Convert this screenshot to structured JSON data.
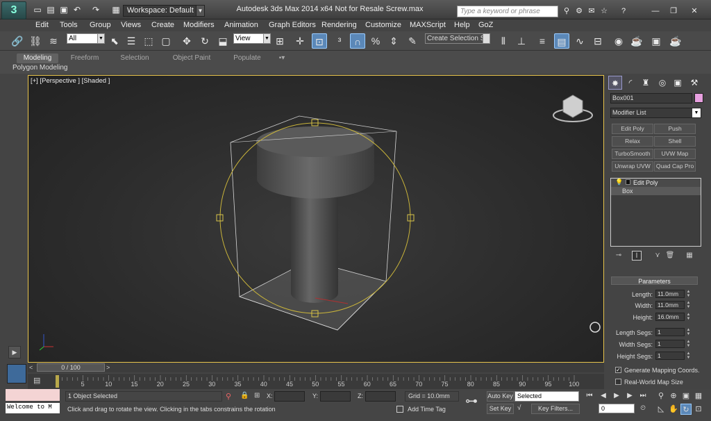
{
  "title_bar": {
    "workspace": "Workspace: Default",
    "window_title": "Autodesk 3ds Max  2014 x64     Not for Resale     Screw.max",
    "search_placeholder": "Type a keyword or phrase"
  },
  "menu": [
    "Edit",
    "Tools",
    "Group",
    "Views",
    "Create",
    "Modifiers",
    "Animation",
    "Graph Editors",
    "Rendering",
    "Customize",
    "MAXScript",
    "Help",
    "GoZ"
  ],
  "toolbar": {
    "selection_filter": "All",
    "reference_coord": "View",
    "selection_set": "Create Selection Se"
  },
  "ribbon": {
    "tabs": [
      "Modeling",
      "Freeform",
      "Selection",
      "Object Paint",
      "Populate"
    ],
    "active_tab": "Modeling",
    "panel_label": "Polygon Modeling"
  },
  "viewport": {
    "label": "[+] [Perspective ] [Shaded ]"
  },
  "command_panel": {
    "object_name": "Box001",
    "object_color": "#e8a0e0",
    "modifier_list": "Modifier List",
    "modifier_buttons": [
      "Edit Poly",
      "Push",
      "Relax",
      "Shell",
      "TurboSmooth",
      "UVW Map",
      "Unwrap UVW",
      "Quad Cap Pro"
    ],
    "stack": [
      "Edit Poly",
      "Box"
    ],
    "rollout_title": "Parameters",
    "params": [
      {
        "label": "Length:",
        "value": "11.0mm"
      },
      {
        "label": "Width:",
        "value": "11.0mm"
      },
      {
        "label": "Height:",
        "value": "16.0mm"
      },
      {
        "label": "Length Segs:",
        "value": "1"
      },
      {
        "label": "Width Segs:",
        "value": "1"
      },
      {
        "label": "Height Segs:",
        "value": "1"
      }
    ],
    "checkboxes": [
      {
        "label": "Generate Mapping Coords.",
        "checked": true
      },
      {
        "label": "Real-World Map Size",
        "checked": false
      }
    ]
  },
  "timeline": {
    "slider": "0 / 100",
    "ticks": [
      "5",
      "10",
      "15",
      "20",
      "25",
      "30",
      "35",
      "40",
      "45",
      "50",
      "55",
      "60",
      "65",
      "70",
      "75",
      "80",
      "85",
      "90",
      "95",
      "100"
    ]
  },
  "status": {
    "listener": "Welcome to M",
    "selected": "1 Object Selected",
    "prompt": "Click and drag to rotate the view.  Clicking in the tabs constrains the rotation",
    "x_label": "X:",
    "y_label": "Y:",
    "z_label": "Z:",
    "grid": "Grid = 10.0mm",
    "add_time_tag": "Add Time Tag",
    "auto_key": "Auto Key",
    "set_key": "Set Key",
    "selected_dd": "Selected",
    "key_filters": "Key Filters...",
    "frame": "0"
  }
}
